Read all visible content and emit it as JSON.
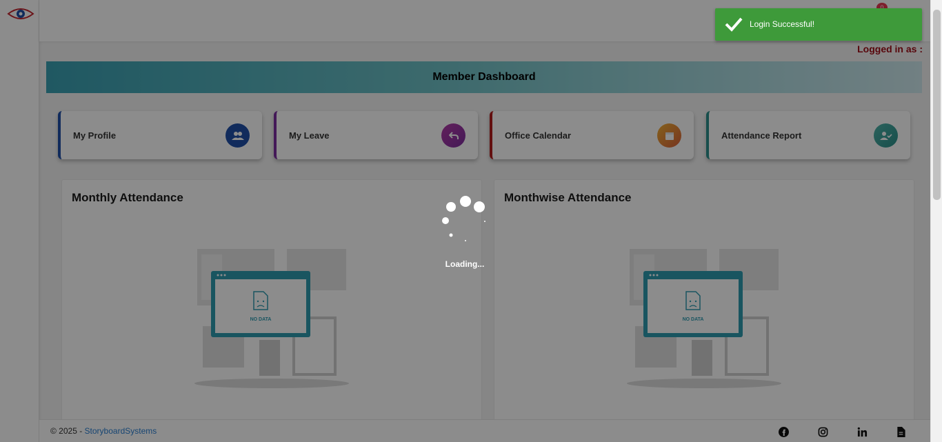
{
  "app": {
    "logged_in_label": "Logged in as :",
    "notification_count": "0"
  },
  "dashboard": {
    "title": "Member Dashboard",
    "cards": [
      {
        "label": "My Profile",
        "icon": "users-icon",
        "color": "#1f4fa8"
      },
      {
        "label": "My Leave",
        "icon": "undo-icon",
        "color": "#7d2fa0"
      },
      {
        "label": "Office Calendar",
        "icon": "calendar-icon",
        "color": "#b41d1d"
      },
      {
        "label": "Attendance Report",
        "icon": "user-check-icon",
        "color": "#2b8f8a"
      }
    ],
    "panels": [
      {
        "title": "Monthly Attendance",
        "empty_label": "NO DATA"
      },
      {
        "title": "Monthwise Attendance",
        "empty_label": "NO DATA"
      }
    ]
  },
  "overlay": {
    "loading_text": "Loading..."
  },
  "toast": {
    "message": "Login Successful!",
    "color": "#3e9a3a"
  },
  "footer": {
    "copyright_prefix": "© 2025 - ",
    "company": "StoryboardSystems",
    "social": [
      "facebook-icon",
      "instagram-icon",
      "linkedin-icon",
      "document-icon"
    ]
  }
}
